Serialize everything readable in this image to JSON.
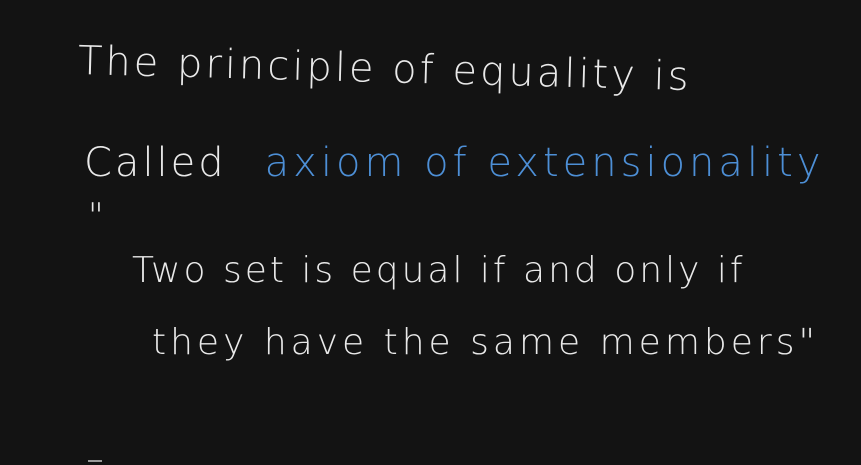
{
  "board": {
    "background_color": "#131313",
    "ink_color": "#e9e9e9",
    "accent_ink_color": "#4d8fd6",
    "lines": {
      "line1": "The principle of equality is",
      "line2_prefix": "Called",
      "line2_highlight": "axiom of extensionality",
      "open_quote": "\"",
      "line4": "Two set is equal if and only if",
      "line5": "they have the same members\""
    }
  }
}
